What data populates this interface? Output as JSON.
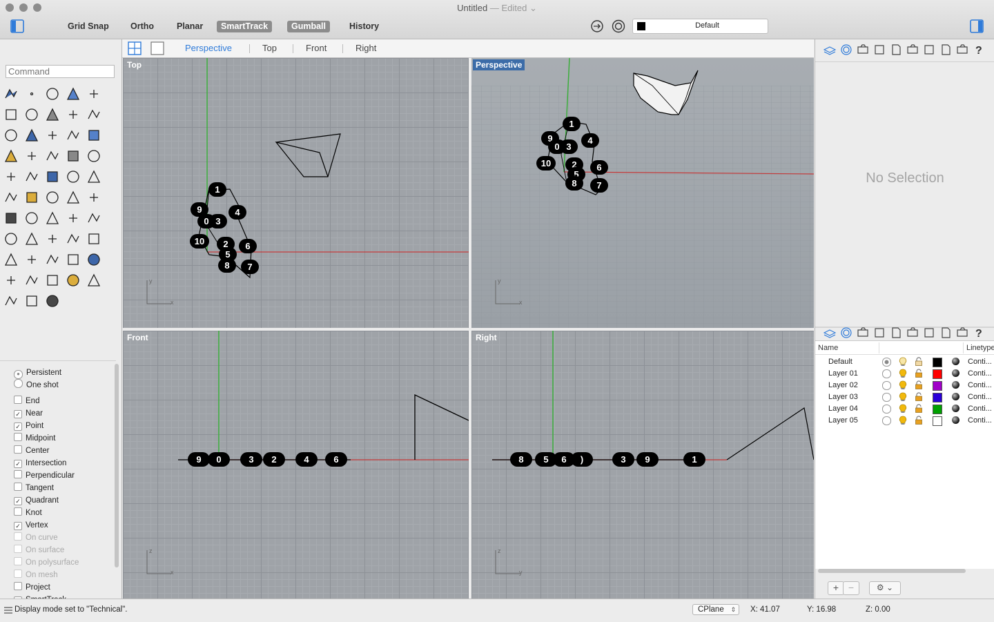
{
  "window": {
    "title": "Untitled",
    "title_suffix": "— Edited",
    "title_chevron": "⌄"
  },
  "toolbar": {
    "toggles": [
      {
        "label": "Grid Snap",
        "on": false
      },
      {
        "label": "Ortho",
        "on": false
      },
      {
        "label": "Planar",
        "on": false
      },
      {
        "label": "SmartTrack",
        "on": true
      },
      {
        "label": "Gumball",
        "on": true
      },
      {
        "label": "History",
        "on": false
      }
    ],
    "layer_selector": {
      "label": "Default",
      "swatch": "#000000"
    }
  },
  "command": {
    "placeholder": "Command"
  },
  "viewport_tabs": [
    "Perspective",
    "Top",
    "Front",
    "Right"
  ],
  "active_tab": "Perspective",
  "viewports": {
    "top": "Top",
    "perspective": "Perspective",
    "front": "Front",
    "right": "Right"
  },
  "axes": {
    "x": "x",
    "y": "y",
    "z": "z"
  },
  "markers": {
    "top": [
      "1",
      "9",
      "4",
      "0",
      "3",
      "10",
      "2",
      "6",
      "5",
      "8",
      "7"
    ],
    "perspective": [
      "1",
      "9",
      "0",
      "3",
      "4",
      "10",
      "2",
      "6",
      "5",
      "8",
      "7"
    ],
    "front": [
      "9",
      "0",
      "3",
      "2",
      "4",
      "6"
    ],
    "right": [
      "8",
      "5",
      "6",
      ")",
      "3",
      "9",
      "1"
    ]
  },
  "snaps": {
    "mode": [
      {
        "label": "Persistent",
        "selected": true
      },
      {
        "label": "One shot",
        "selected": false
      }
    ],
    "items": [
      {
        "label": "End",
        "checked": false,
        "enabled": true
      },
      {
        "label": "Near",
        "checked": true,
        "enabled": true
      },
      {
        "label": "Point",
        "checked": true,
        "enabled": true
      },
      {
        "label": "Midpoint",
        "checked": false,
        "enabled": true
      },
      {
        "label": "Center",
        "checked": false,
        "enabled": true
      },
      {
        "label": "Intersection",
        "checked": true,
        "enabled": true
      },
      {
        "label": "Perpendicular",
        "checked": false,
        "enabled": true
      },
      {
        "label": "Tangent",
        "checked": false,
        "enabled": true
      },
      {
        "label": "Quadrant",
        "checked": true,
        "enabled": true
      },
      {
        "label": "Knot",
        "checked": false,
        "enabled": true
      },
      {
        "label": "Vertex",
        "checked": true,
        "enabled": true
      },
      {
        "label": "On curve",
        "checked": false,
        "enabled": false
      },
      {
        "label": "On surface",
        "checked": false,
        "enabled": false
      },
      {
        "label": "On polysurface",
        "checked": false,
        "enabled": false
      },
      {
        "label": "On mesh",
        "checked": false,
        "enabled": false
      },
      {
        "label": "Project",
        "checked": false,
        "enabled": true
      },
      {
        "label": "SmartTrack",
        "checked": true,
        "enabled": true
      }
    ]
  },
  "properties": {
    "empty_message": "No Selection"
  },
  "layers": {
    "columns": {
      "name": "Name",
      "linetype": "Linetype"
    },
    "rows": [
      {
        "name": "Default",
        "current": true,
        "on": false,
        "locked": false,
        "color": "#000000",
        "linetype": "Conti..."
      },
      {
        "name": "Layer 01",
        "current": false,
        "on": true,
        "locked": true,
        "color": "#ff0000",
        "linetype": "Conti..."
      },
      {
        "name": "Layer 02",
        "current": false,
        "on": true,
        "locked": true,
        "color": "#a000c8",
        "linetype": "Conti..."
      },
      {
        "name": "Layer 03",
        "current": false,
        "on": true,
        "locked": true,
        "color": "#2a00d8",
        "linetype": "Conti..."
      },
      {
        "name": "Layer 04",
        "current": false,
        "on": true,
        "locked": true,
        "color": "#00a000",
        "linetype": "Conti..."
      },
      {
        "name": "Layer 05",
        "current": false,
        "on": true,
        "locked": true,
        "color": "#ffffff",
        "linetype": "Conti..."
      }
    ],
    "add_label": "+",
    "remove_label": "−",
    "gear_label": "⚙ ⌄"
  },
  "status": {
    "message": "Display mode set to \"Technical\".",
    "cplane": "CPlane",
    "x": "X: 41.07",
    "y": "Y: 16.98",
    "z": "Z: 0.00"
  }
}
